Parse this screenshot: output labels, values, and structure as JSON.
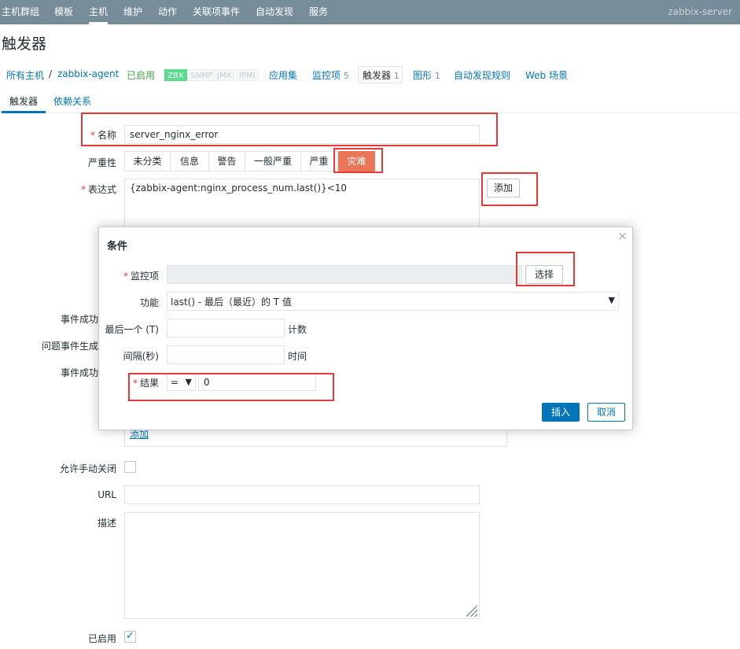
{
  "topnav": {
    "items": [
      "主机群组",
      "模板",
      "主机",
      "维护",
      "动作",
      "关联项事件",
      "自动发现",
      "服务"
    ],
    "server": "zabbix-server"
  },
  "page_title": "触发器",
  "hostnav": {
    "all_hosts": "所有主机",
    "separator": "/",
    "host": "zabbix-agent",
    "status": "已启用",
    "tags": [
      "ZBX",
      "SNMP",
      "JMX",
      "IPMI"
    ],
    "apps": "应用集",
    "items": "监控项",
    "items_count": "5",
    "triggers": "触发器",
    "triggers_count": "1",
    "graphs": "图形",
    "graphs_count": "1",
    "discovery": "自动发现规则",
    "web": "Web 场景"
  },
  "tabs": [
    "触发器",
    "依赖关系"
  ],
  "form": {
    "name_label": "名称",
    "name_value": "server_nginx_error",
    "severity_label": "严重性",
    "severities": [
      "未分类",
      "信息",
      "警告",
      "一般严重",
      "严重",
      "灾难"
    ],
    "expression_label": "表达式",
    "expression_value": "{zabbix-agent:nginx_process_num.last()}<10",
    "add_button": "添加",
    "event_ok_label": "事件成功",
    "problem_event_label": "问题事件生成",
    "event_ok_label2": "事件成功",
    "tag_add_link": "添加",
    "manual_close_label": "允许手动关闭",
    "url_label": "URL",
    "description_label": "描述",
    "enabled_label": "已启用"
  },
  "dialog": {
    "title": "条件",
    "item_label": "监控项",
    "select_button": "选择",
    "function_label": "功能",
    "function_value": "last() - 最后（最近）的 T 值",
    "last_label": "最后一个 (T)",
    "last_suffix": "计数",
    "interval_label": "间隔(秒)",
    "interval_suffix": "时间",
    "result_label": "结果",
    "result_operator": "=",
    "result_value": "0",
    "insert_button": "插入",
    "cancel_button": "取消"
  },
  "colors": {
    "nav_bg": "#768d99",
    "link": "#0275b8",
    "disaster": "#e97659",
    "highlight_box": "#e53935",
    "required": "#e33734"
  }
}
